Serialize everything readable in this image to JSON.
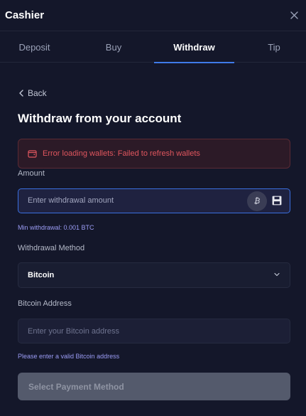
{
  "header": {
    "title": "Cashier",
    "close_icon": "close-icon"
  },
  "tabs": [
    {
      "label": "Deposit",
      "active": false
    },
    {
      "label": "Buy",
      "active": false
    },
    {
      "label": "Withdraw",
      "active": true
    },
    {
      "label": "Tip",
      "active": false
    }
  ],
  "back": {
    "label": "Back",
    "icon": "chevron-left-icon"
  },
  "page": {
    "heading": "Withdraw from your account"
  },
  "error": {
    "message": "Error loading wallets: Failed to refresh wallets",
    "icon": "wallet-icon",
    "color": "#e0565e"
  },
  "amount": {
    "label": "Amount",
    "placeholder": "Enter withdrawal amount",
    "value": "",
    "currency_symbol": "₿",
    "save_icon": "save-icon",
    "min_hint": "Min withdrawal: 0.001 BTC"
  },
  "method": {
    "label": "Withdrawal Method",
    "selected": "Bitcoin",
    "chevron_icon": "chevron-down-icon"
  },
  "address": {
    "label": "Bitcoin Address",
    "placeholder": "Enter your Bitcoin address",
    "value": "",
    "hint": "Please enter a valid Bitcoin address"
  },
  "submit": {
    "label": "Select Payment Method",
    "disabled": true
  },
  "colors": {
    "background": "#14172a",
    "accent": "#3f7be9",
    "hint": "#9b9cf5",
    "button_disabled": "#545a6c"
  }
}
